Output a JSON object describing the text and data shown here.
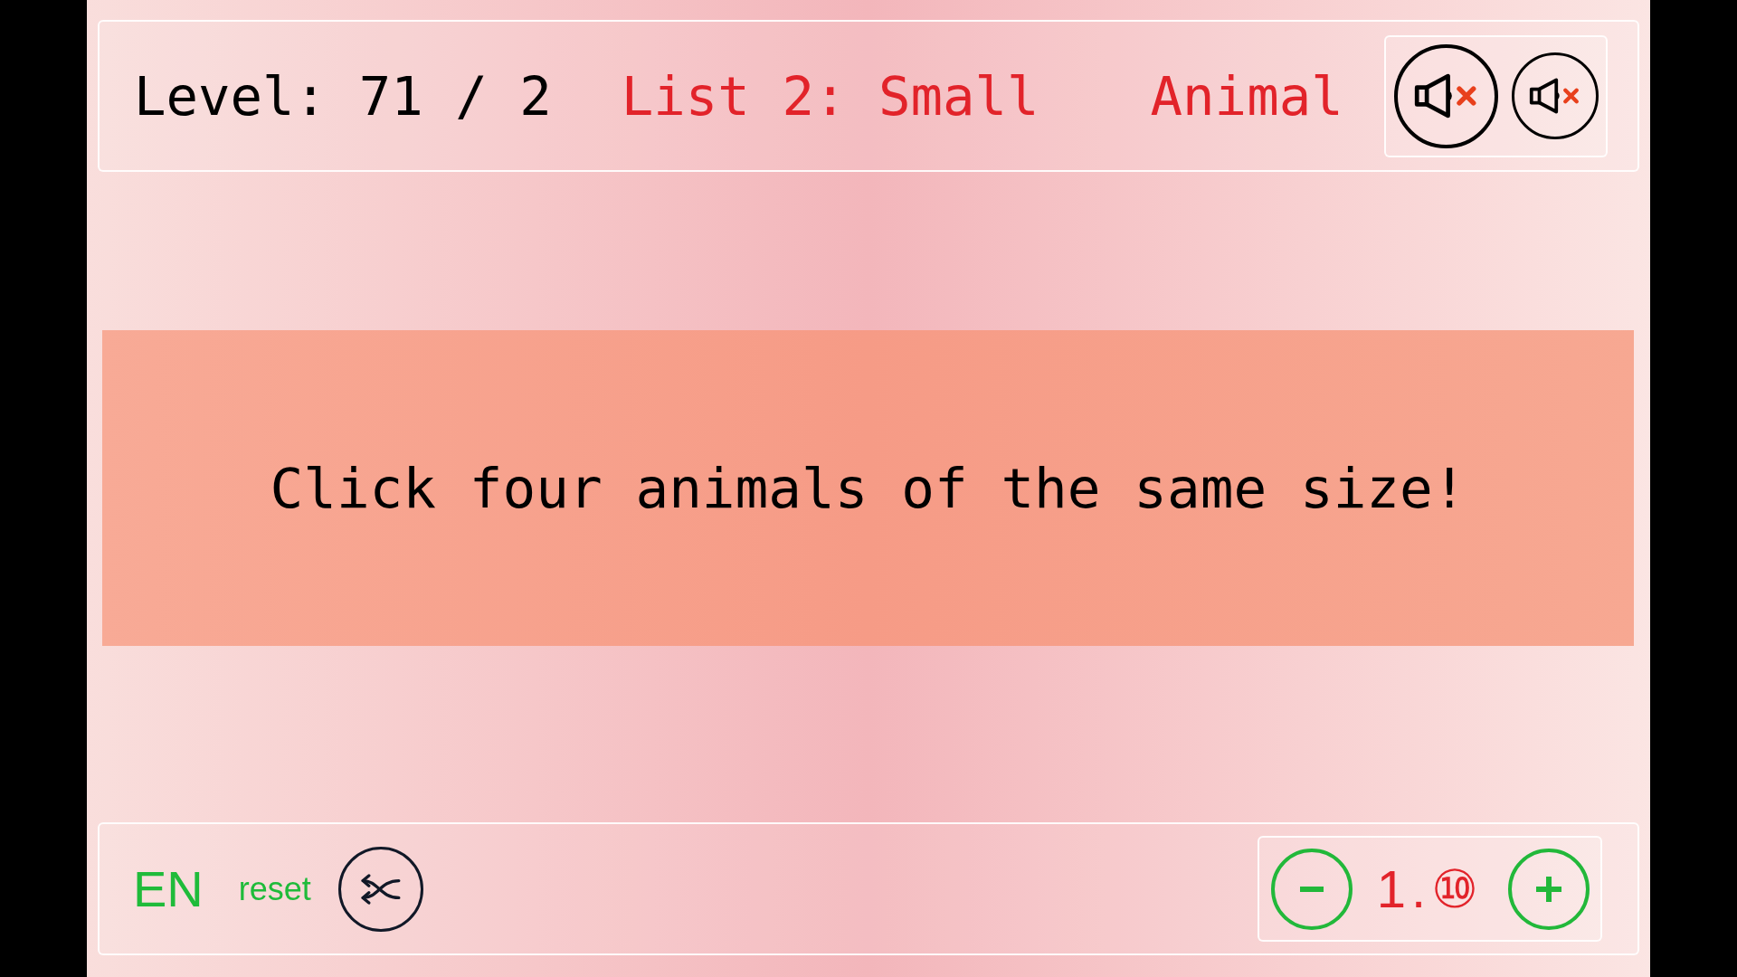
{
  "header": {
    "level": "Level: 71 / 2",
    "list": "List 2: Small",
    "category": "Animal",
    "sound_buttons": [
      {
        "muted": true
      },
      {
        "muted": true
      }
    ]
  },
  "instruction": "Click four animals of the same size!",
  "footer": {
    "language": "EN",
    "reset": "reset",
    "counter": {
      "value": "1.⑩"
    }
  }
}
